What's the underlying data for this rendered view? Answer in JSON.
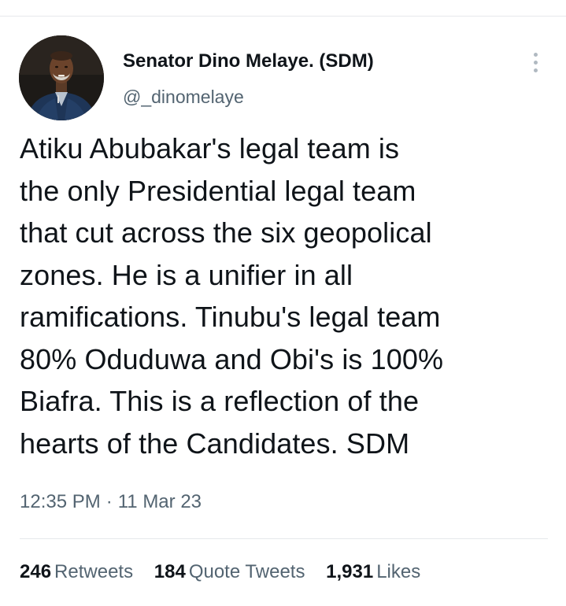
{
  "author": {
    "display_name": "Senator Dino Melaye. (SDM)",
    "handle": "@_dinomelaye",
    "avatar": "profile-photo"
  },
  "more_icon": "more-vertical-icon",
  "tweet": {
    "lines": [
      "Atiku Abubakar's legal team is",
      "the only Presidential legal team",
      "that cut across the six geopolical",
      "zones. He is a unifier in all",
      "ramifications. Tinubu's legal team",
      "80% Oduduwa and Obi's is 100%",
      "Biafra. This is a reflection of the",
      "hearts of the Candidates. SDM"
    ]
  },
  "meta": {
    "time": "12:35 PM",
    "separator": "·",
    "date": "11 Mar 23"
  },
  "stats": [
    {
      "count": "246",
      "label": "Retweets"
    },
    {
      "count": "184",
      "label": "Quote Tweets"
    },
    {
      "count": "1,931",
      "label": "Likes"
    }
  ],
  "colors": {
    "text": "#0f1419",
    "secondary": "#536471",
    "divider": "#e6e9eb"
  }
}
